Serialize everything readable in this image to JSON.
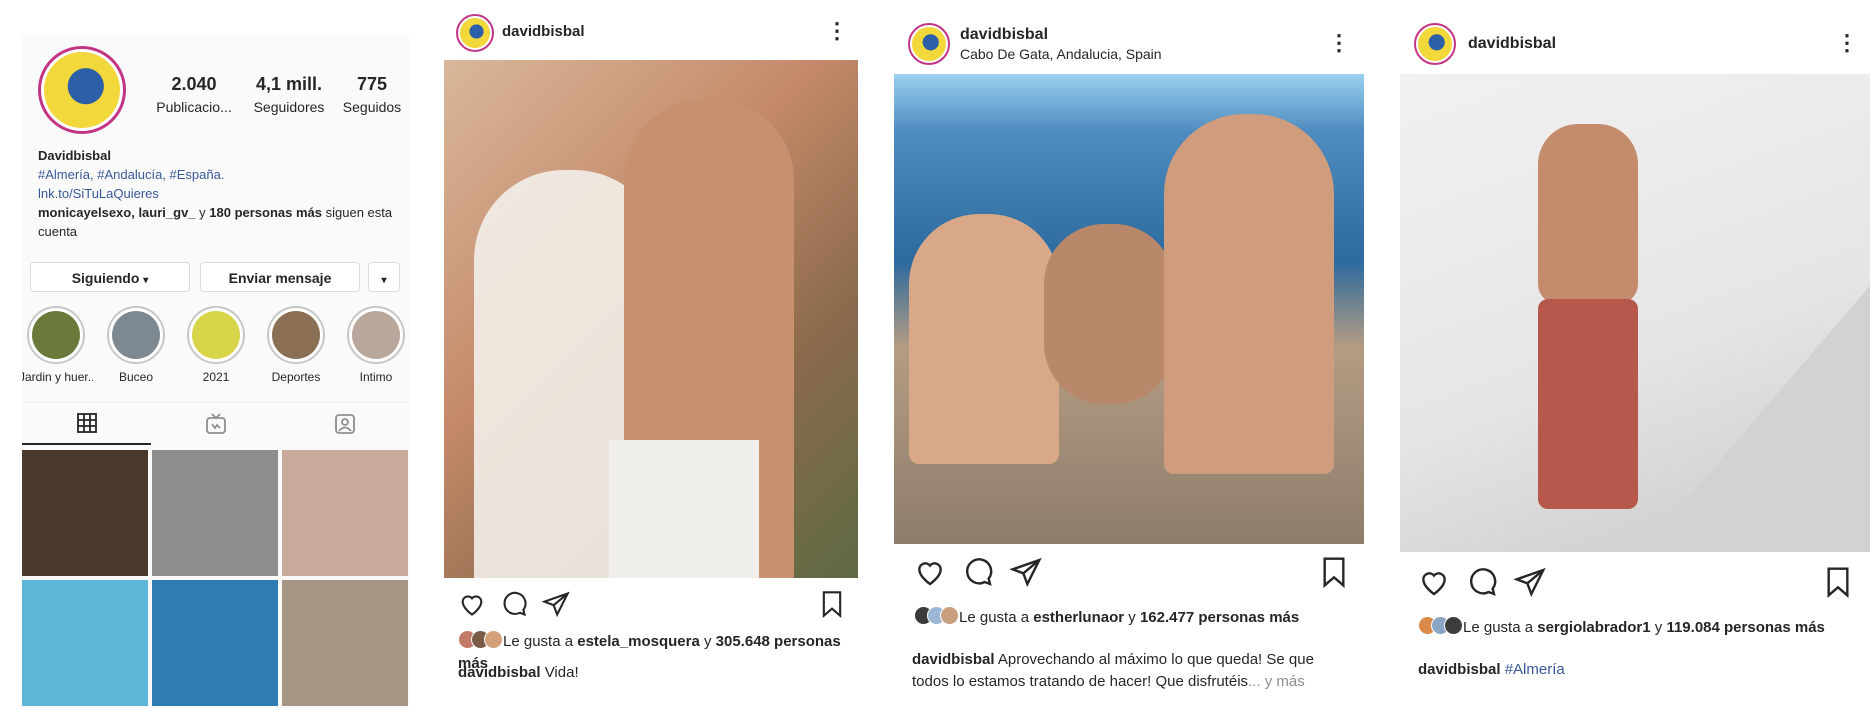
{
  "profile": {
    "stats": [
      {
        "value": "2.040",
        "label": "Publicacio..."
      },
      {
        "value": "4,1 mill.",
        "label": "Seguidores"
      },
      {
        "value": "775",
        "label": "Seguidos"
      }
    ],
    "name": "Davidbisbal",
    "hashtags": "#Almería, #Andalucía, #España.",
    "link": "lnk.to/SiTuLaQuieres",
    "followed_by_names": "monicayelsexo, lauri_gv_",
    "followed_by_mid": " y ",
    "followed_by_count": "180 personas más",
    "followed_by_suffix": " siguen esta cuenta",
    "following_button": "Siguiendo",
    "message_button": "Enviar mensaje",
    "highlights": [
      {
        "label": "Jardin y huer...",
        "color": "#6a7a3a"
      },
      {
        "label": "Buceo",
        "color": "#7d8890"
      },
      {
        "label": "2021",
        "color": "#d8d44a"
      },
      {
        "label": "Deportes",
        "color": "#8a6f55"
      },
      {
        "label": "Intimo",
        "color": "#b9a79c"
      }
    ],
    "grid_colors": [
      "#4a3a2e",
      "#8e8e8e",
      "#c9a99a",
      "#5db8d8",
      "#2f7bb3",
      "#a69584"
    ]
  },
  "posts": [
    {
      "username": "davidbisbal",
      "location": "",
      "liked_prefix": "Le gusta a ",
      "liked_user": "estela_mosquera",
      "liked_mid": " y ",
      "liked_count": "305.648 personas más",
      "caption_user": "davidbisbal",
      "caption_text": " Vida!",
      "caption_more": ""
    },
    {
      "username": "davidbisbal",
      "location": "Cabo De Gata, Andalucia, Spain",
      "liked_prefix": "Le gusta a ",
      "liked_user": "estherlunaor",
      "liked_mid": " y ",
      "liked_count": "162.477 personas más",
      "caption_user": "davidbisbal",
      "caption_text": " Aprovechando al máximo lo que queda! Se que todos lo estamos tratando de hacer! Que disfrutéis",
      "caption_more": "... y más"
    },
    {
      "username": "davidbisbal",
      "location": "",
      "liked_prefix": "Le gusta a ",
      "liked_user": "sergiolabrador1",
      "liked_mid": " y ",
      "liked_count": "119.084 personas más",
      "caption_user": "davidbisbal",
      "caption_text": "",
      "caption_more": "#Almería"
    }
  ]
}
